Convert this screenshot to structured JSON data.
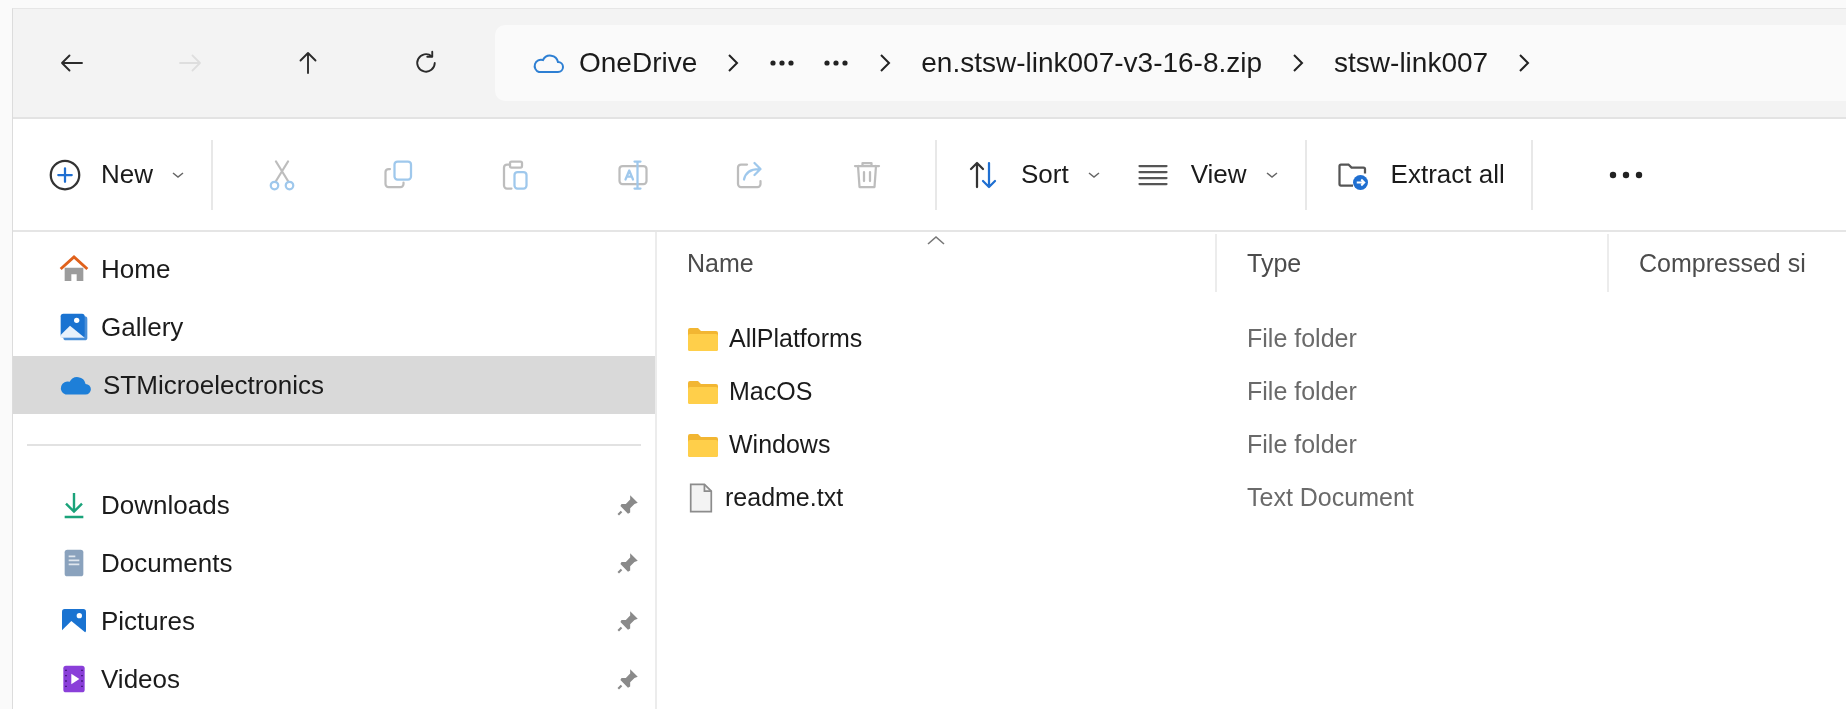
{
  "nav": {
    "buttons": [
      {
        "kind": "back",
        "disabled": false
      },
      {
        "kind": "forward",
        "disabled": true
      },
      {
        "kind": "up",
        "disabled": false
      },
      {
        "kind": "refresh",
        "disabled": false
      }
    ]
  },
  "address": {
    "crumbs": [
      {
        "kind": "cloud-crumb",
        "label": "OneDrive"
      },
      {
        "kind": "chevron"
      },
      {
        "kind": "overflow"
      },
      {
        "kind": "overflow"
      },
      {
        "kind": "chevron"
      },
      {
        "kind": "crumb",
        "label": "en.stsw-link007-v3-16-8.zip"
      },
      {
        "kind": "chevron"
      },
      {
        "kind": "crumb",
        "label": "stsw-link007"
      },
      {
        "kind": "chevron"
      }
    ]
  },
  "toolbar": {
    "items": [
      {
        "kind": "new",
        "label": "New",
        "disabled": false
      },
      {
        "kind": "divider"
      },
      {
        "kind": "cut",
        "disabled": true
      },
      {
        "kind": "copy",
        "disabled": true
      },
      {
        "kind": "paste",
        "disabled": true
      },
      {
        "kind": "rename",
        "disabled": true
      },
      {
        "kind": "share",
        "disabled": true
      },
      {
        "kind": "delete",
        "disabled": true
      },
      {
        "kind": "divider"
      },
      {
        "kind": "sort",
        "label": "Sort",
        "disabled": false
      },
      {
        "kind": "view",
        "label": "View",
        "disabled": false
      },
      {
        "kind": "divider"
      },
      {
        "kind": "extract",
        "label": "Extract all",
        "disabled": false
      },
      {
        "kind": "divider"
      },
      {
        "kind": "more",
        "disabled": false
      }
    ]
  },
  "sidebar": {
    "groups": [
      {
        "items": [
          {
            "kind": "home",
            "label": "Home",
            "selected": false,
            "pinned": false
          },
          {
            "kind": "gallery",
            "label": "Gallery",
            "selected": false,
            "pinned": false
          },
          {
            "kind": "onedrive",
            "label": "STMicroelectronics",
            "selected": true,
            "pinned": false
          }
        ]
      },
      {
        "items": [
          {
            "kind": "downloads",
            "label": "Downloads",
            "selected": false,
            "pinned": true
          },
          {
            "kind": "documents",
            "label": "Documents",
            "selected": false,
            "pinned": true
          },
          {
            "kind": "pictures",
            "label": "Pictures",
            "selected": false,
            "pinned": true
          },
          {
            "kind": "videos",
            "label": "Videos",
            "selected": false,
            "pinned": true
          }
        ]
      }
    ]
  },
  "table": {
    "columns": [
      {
        "label": "Name",
        "sorted": true
      },
      {
        "label": "Type",
        "sorted": false
      },
      {
        "label": "Compressed si",
        "sorted": false
      }
    ],
    "rows": [
      {
        "kind": "folder",
        "name": "AllPlatforms",
        "type": "File folder"
      },
      {
        "kind": "folder",
        "name": "MacOS",
        "type": "File folder"
      },
      {
        "kind": "folder",
        "name": "Windows",
        "type": "File folder"
      },
      {
        "kind": "text",
        "name": "readme.txt",
        "type": "Text Document"
      }
    ]
  }
}
